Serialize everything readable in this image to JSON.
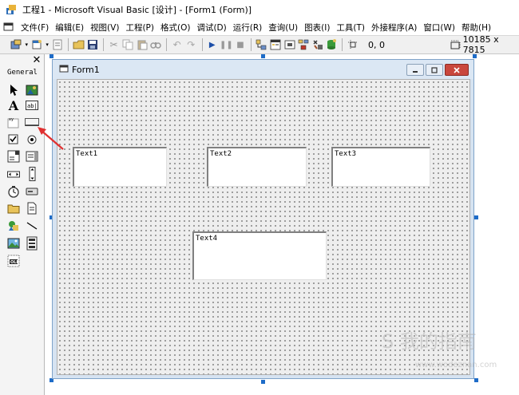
{
  "window": {
    "title": "工程1 - Microsoft Visual Basic [设计] - [Form1 (Form)]"
  },
  "menu": {
    "items": [
      "文件(F)",
      "编辑(E)",
      "视图(V)",
      "工程(P)",
      "格式(O)",
      "调试(D)",
      "运行(R)",
      "查询(U)",
      "图表(I)",
      "工具(T)",
      "外接程序(A)",
      "窗口(W)",
      "帮助(H)"
    ]
  },
  "toolbar": {
    "position_readout": "0, 0",
    "size_readout": "10185 x 7815"
  },
  "toolbox": {
    "tab_label": "General",
    "close_glyph": "✕",
    "tools": [
      {
        "name": "pointer-tool",
        "glyph": "➤"
      },
      {
        "name": "picturebox-tool",
        "glyph": "▣"
      },
      {
        "name": "label-tool",
        "glyph": "A"
      },
      {
        "name": "textbox-tool",
        "glyph": "ab|"
      },
      {
        "name": "frame-tool",
        "glyph": "xy"
      },
      {
        "name": "commandbutton-tool",
        "glyph": "▭"
      },
      {
        "name": "checkbox-tool",
        "glyph": "☑"
      },
      {
        "name": "optionbutton-tool",
        "glyph": "◉"
      },
      {
        "name": "combobox-tool",
        "glyph": "☰"
      },
      {
        "name": "listbox-tool",
        "glyph": "☰"
      },
      {
        "name": "hscrollbar-tool",
        "glyph": "◂▸"
      },
      {
        "name": "vscrollbar-tool",
        "glyph": "▴▾"
      },
      {
        "name": "timer-tool",
        "glyph": "⏱"
      },
      {
        "name": "drivelistbox-tool",
        "glyph": "▭"
      },
      {
        "name": "dirlistbox-tool",
        "glyph": "▬"
      },
      {
        "name": "filelistbox-tool",
        "glyph": "▤"
      },
      {
        "name": "shape-tool",
        "glyph": "◈"
      },
      {
        "name": "line-tool",
        "glyph": "╲"
      },
      {
        "name": "image-tool",
        "glyph": "▨"
      },
      {
        "name": "data-tool",
        "glyph": "▦"
      },
      {
        "name": "ole-tool",
        "glyph": "OLE"
      }
    ]
  },
  "form": {
    "title": "Form1",
    "textboxes": [
      "Text1",
      "Text2",
      "Text3",
      "Text4"
    ]
  },
  "watermark": {
    "text": "S 我的指南",
    "url": "www.wodeznan.com"
  }
}
